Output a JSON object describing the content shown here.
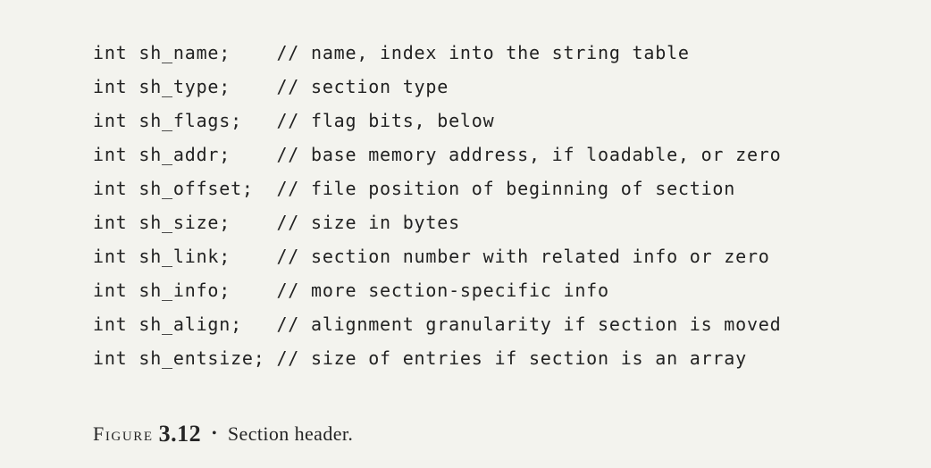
{
  "code": {
    "lines": [
      {
        "decl": "int sh_name;    ",
        "comment": "// name, index into the string table"
      },
      {
        "decl": "int sh_type;    ",
        "comment": "// section type"
      },
      {
        "decl": "int sh_flags;   ",
        "comment": "// flag bits, below"
      },
      {
        "decl": "int sh_addr;    ",
        "comment": "// base memory address, if loadable, or zero"
      },
      {
        "decl": "int sh_offset;  ",
        "comment": "// file position of beginning of section"
      },
      {
        "decl": "int sh_size;    ",
        "comment": "// size in bytes"
      },
      {
        "decl": "int sh_link;    ",
        "comment": "// section number with related info or zero"
      },
      {
        "decl": "int sh_info;    ",
        "comment": "// more section-specific info"
      },
      {
        "decl": "int sh_align;   ",
        "comment": "// alignment granularity if section is moved"
      },
      {
        "decl": "int sh_entsize; ",
        "comment": "// size of entries if section is an array"
      }
    ]
  },
  "caption": {
    "label": "Figure",
    "number": "3.12",
    "bullet": "•",
    "text": "Section header."
  }
}
